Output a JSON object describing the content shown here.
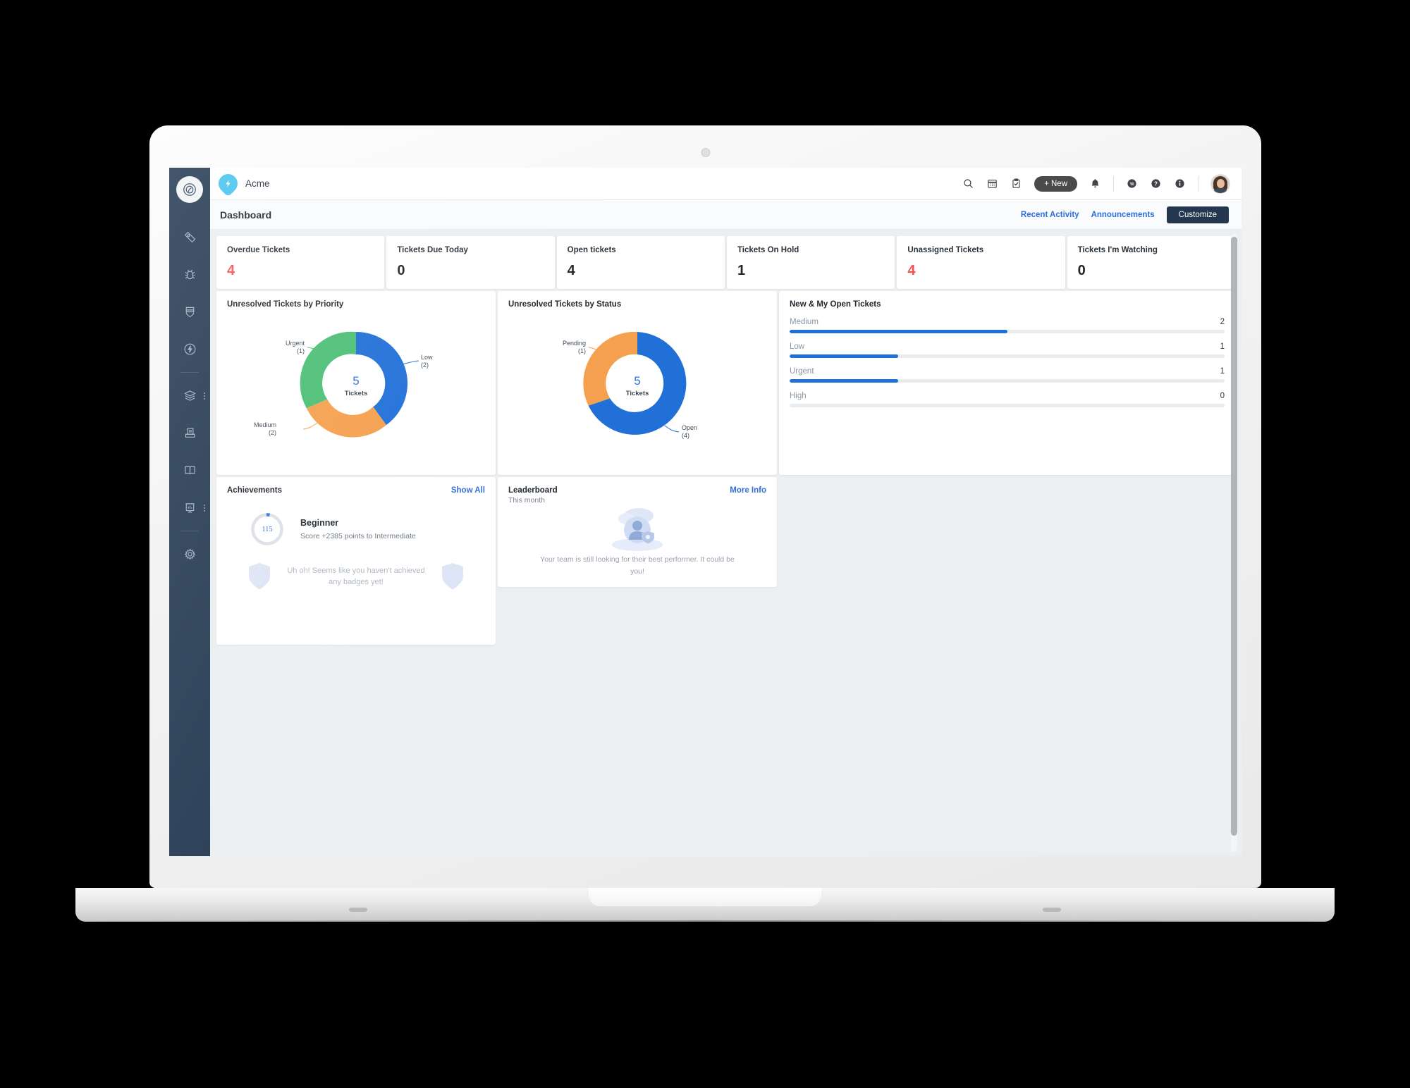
{
  "sidebar": {
    "logo_icon": "speedometer-icon",
    "items": [
      {
        "name": "dashboard",
        "icon": "speedometer-icon",
        "active": true,
        "kebab": false
      },
      {
        "name": "tickets",
        "icon": "ticket-icon",
        "active": false,
        "kebab": false
      },
      {
        "name": "problems",
        "icon": "bug-icon",
        "active": false,
        "kebab": false
      },
      {
        "name": "changes",
        "icon": "shield-icon",
        "active": false,
        "kebab": false
      },
      {
        "name": "releases",
        "icon": "bolt-circle-icon",
        "active": false,
        "kebab": false
      },
      {
        "name": "assets",
        "icon": "layers-icon",
        "active": false,
        "kebab": true
      },
      {
        "name": "contracts",
        "icon": "archive-icon",
        "active": false,
        "kebab": false
      },
      {
        "name": "solutions",
        "icon": "book-icon",
        "active": false,
        "kebab": false
      },
      {
        "name": "reports",
        "icon": "presentation-chart-icon",
        "active": false,
        "kebab": true
      },
      {
        "name": "admin",
        "icon": "gear-icon",
        "active": false,
        "kebab": false
      }
    ]
  },
  "topbar": {
    "brand_name": "Acme",
    "brand_icon": "bolt-droplet-icon",
    "new_button": "+ New",
    "icons": [
      "search-icon",
      "calendar-icon",
      "clipboard-check-icon",
      "bell-icon",
      "chat-icon",
      "help-icon",
      "info-icon"
    ],
    "avatar": "user-avatar"
  },
  "page_header": {
    "title": "Dashboard",
    "recent_activity": "Recent Activity",
    "announcements": "Announcements",
    "customize": "Customize"
  },
  "kpis": [
    {
      "label": "Overdue Tickets",
      "value": "4",
      "danger": true
    },
    {
      "label": "Tickets Due Today",
      "value": "0",
      "danger": false
    },
    {
      "label": "Open tickets",
      "value": "4",
      "danger": false
    },
    {
      "label": "Tickets On Hold",
      "value": "1",
      "danger": false
    },
    {
      "label": "Unassigned Tickets",
      "value": "4",
      "danger": true
    },
    {
      "label": "Tickets I'm Watching",
      "value": "0",
      "danger": false
    }
  ],
  "open_tickets": {
    "title": "New & My Open Tickets",
    "rows": [
      {
        "label": "Medium",
        "value": "2",
        "pct": 50
      },
      {
        "label": "Low",
        "value": "1",
        "pct": 25
      },
      {
        "label": "Urgent",
        "value": "1",
        "pct": 25
      },
      {
        "label": "High",
        "value": "0",
        "pct": 0
      }
    ],
    "bar_color": "#2170d8",
    "track_color": "#e9ecef"
  },
  "achievements": {
    "title": "Achievements",
    "show_all": "Show All",
    "score": "115",
    "level": "Beginner",
    "progress_text": "Score +2385 points to Intermediate",
    "empty_badges": "Uh oh! Seems like you haven't achieved any badges yet!"
  },
  "leaderboard": {
    "title": "Leaderboard",
    "subtitle": "This month",
    "more_info": "More Info",
    "empty_text": "Your team is still looking for their best performer. It could be you!"
  },
  "chart_data": [
    {
      "type": "pie",
      "title": "Unresolved Tickets by Priority",
      "categories": [
        "Low",
        "Medium",
        "Urgent"
      ],
      "values": [
        2,
        2,
        1
      ],
      "colors": [
        "#2170d8",
        "#f5a04e",
        "#4cbf76"
      ],
      "center_value": "5",
      "center_label": "Tickets",
      "labels": [
        "Low\n(2)",
        "Medium\n(2)",
        "Urgent\n(1)"
      ],
      "legend": "callout",
      "total": 5
    },
    {
      "type": "pie",
      "title": "Unresolved Tickets by Status",
      "categories": [
        "Open",
        "Pending"
      ],
      "values": [
        4,
        1
      ],
      "colors": [
        "#2170d8",
        "#f5a04e"
      ],
      "center_value": "5",
      "center_label": "Tickets",
      "labels": [
        "Open\n(4)",
        "Pending\n(1)"
      ],
      "legend": "callout",
      "total": 5
    }
  ]
}
